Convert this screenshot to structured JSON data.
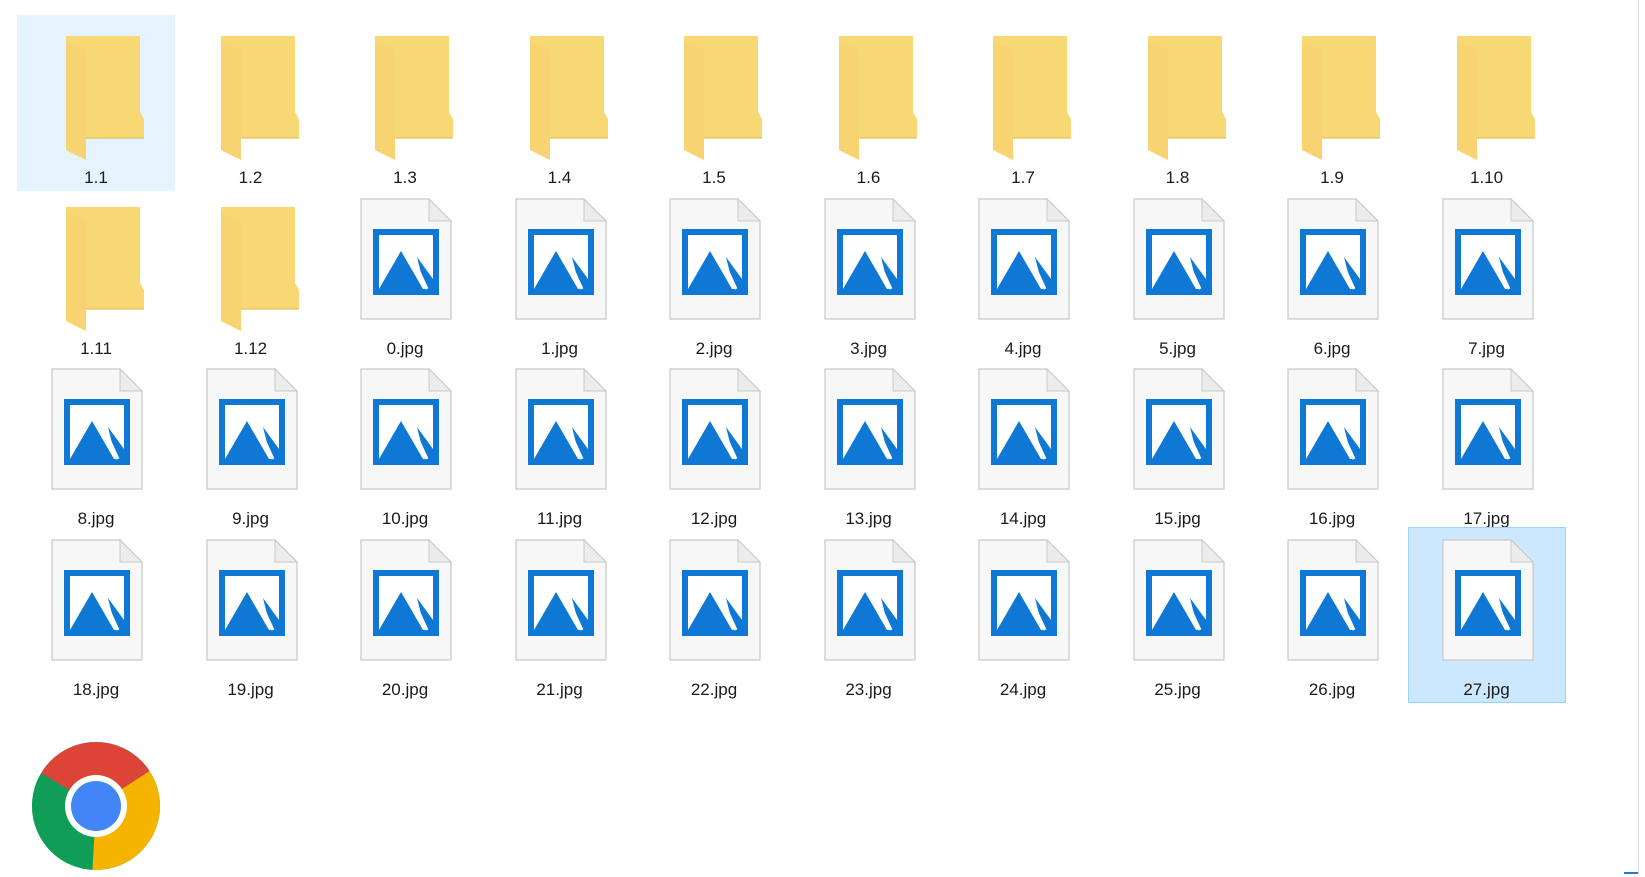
{
  "explorer": {
    "view_mode": "Large icons",
    "items": [
      {
        "name": "1.1",
        "type": "folder",
        "state": "hover"
      },
      {
        "name": "1.2",
        "type": "folder"
      },
      {
        "name": "1.3",
        "type": "folder"
      },
      {
        "name": "1.4",
        "type": "folder"
      },
      {
        "name": "1.5",
        "type": "folder"
      },
      {
        "name": "1.6",
        "type": "folder"
      },
      {
        "name": "1.7",
        "type": "folder"
      },
      {
        "name": "1.8",
        "type": "folder"
      },
      {
        "name": "1.9",
        "type": "folder"
      },
      {
        "name": "1.10",
        "type": "folder"
      },
      {
        "name": "1.11",
        "type": "folder"
      },
      {
        "name": "1.12",
        "type": "folder"
      },
      {
        "name": "0.jpg",
        "type": "image"
      },
      {
        "name": "1.jpg",
        "type": "image"
      },
      {
        "name": "2.jpg",
        "type": "image"
      },
      {
        "name": "3.jpg",
        "type": "image"
      },
      {
        "name": "4.jpg",
        "type": "image"
      },
      {
        "name": "5.jpg",
        "type": "image"
      },
      {
        "name": "6.jpg",
        "type": "image"
      },
      {
        "name": "7.jpg",
        "type": "image"
      },
      {
        "name": "8.jpg",
        "type": "image"
      },
      {
        "name": "9.jpg",
        "type": "image"
      },
      {
        "name": "10.jpg",
        "type": "image"
      },
      {
        "name": "11.jpg",
        "type": "image"
      },
      {
        "name": "12.jpg",
        "type": "image"
      },
      {
        "name": "13.jpg",
        "type": "image"
      },
      {
        "name": "14.jpg",
        "type": "image"
      },
      {
        "name": "15.jpg",
        "type": "image"
      },
      {
        "name": "16.jpg",
        "type": "image"
      },
      {
        "name": "17.jpg",
        "type": "image"
      },
      {
        "name": "18.jpg",
        "type": "image"
      },
      {
        "name": "19.jpg",
        "type": "image"
      },
      {
        "name": "20.jpg",
        "type": "image"
      },
      {
        "name": "21.jpg",
        "type": "image"
      },
      {
        "name": "22.jpg",
        "type": "image"
      },
      {
        "name": "23.jpg",
        "type": "image"
      },
      {
        "name": "24.jpg",
        "type": "image"
      },
      {
        "name": "25.jpg",
        "type": "image"
      },
      {
        "name": "26.jpg",
        "type": "image"
      },
      {
        "name": "27.jpg",
        "type": "image",
        "state": "selected"
      }
    ],
    "shortcut": {
      "icon": "chrome-icon"
    }
  },
  "colors": {
    "folder_front": "#f8d775",
    "folder_back": "#eac15a",
    "image_accent": "#0f78d4",
    "hover_bg": "#e5f3ff",
    "selected_bg": "#cce8ff",
    "selected_border": "#99d1ff"
  }
}
